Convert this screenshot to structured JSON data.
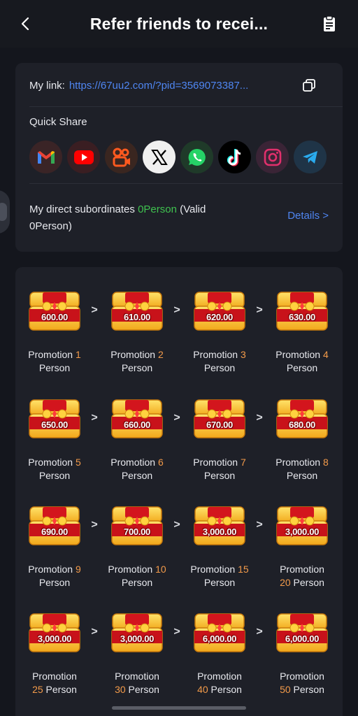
{
  "header": {
    "title": "Refer friends to recei...",
    "back_icon": "chevron-left-icon",
    "right_icon": "clipboard-icon"
  },
  "referral": {
    "link_label": "My link:",
    "link_url": "https://67uu2.com/?pid=3569073387...",
    "copy_icon": "copy-icon"
  },
  "quick_share": {
    "title": "Quick Share",
    "apps": [
      {
        "name": "gmail",
        "bg": "#3a2426"
      },
      {
        "name": "youtube",
        "bg": "#3a1e22"
      },
      {
        "name": "kuaishou",
        "bg": "#3a2620"
      },
      {
        "name": "x",
        "bg": "#f0f0f0"
      },
      {
        "name": "whatsapp",
        "bg": "#1f3a29"
      },
      {
        "name": "tiktok",
        "bg": "#000000"
      },
      {
        "name": "instagram",
        "bg": "#3a2436"
      },
      {
        "name": "telegram",
        "bg": "#1f3447"
      }
    ]
  },
  "subordinates": {
    "text_prefix": "My direct subordinates ",
    "count": "0Person",
    "valid_prefix": " (Valid",
    "valid_line2": "0Person)",
    "details_label": "Details >"
  },
  "rewards": [
    {
      "amount": "600.00",
      "label": "Promotion",
      "num": "1",
      "unit": "Person"
    },
    {
      "amount": "610.00",
      "label": "Promotion",
      "num": "2",
      "unit": "Person"
    },
    {
      "amount": "620.00",
      "label": "Promotion",
      "num": "3",
      "unit": "Person"
    },
    {
      "amount": "630.00",
      "label": "Promotion",
      "num": "4",
      "unit": "Person"
    },
    {
      "amount": "650.00",
      "label": "Promotion",
      "num": "5",
      "unit": "Person"
    },
    {
      "amount": "660.00",
      "label": "Promotion",
      "num": "6",
      "unit": "Person"
    },
    {
      "amount": "670.00",
      "label": "Promotion",
      "num": "7",
      "unit": "Person"
    },
    {
      "amount": "680.00",
      "label": "Promotion",
      "num": "8",
      "unit": "Person"
    },
    {
      "amount": "690.00",
      "label": "Promotion",
      "num": "9",
      "unit": "Person"
    },
    {
      "amount": "700.00",
      "label": "Promotion",
      "num": "10",
      "unit": "Person"
    },
    {
      "amount": "3,000.00",
      "label": "Promotion",
      "num": "15",
      "unit": "Person"
    },
    {
      "amount": "3,000.00",
      "label": "Promotion",
      "num": "20",
      "unit": "Person"
    },
    {
      "amount": "3,000.00",
      "label": "Promotion",
      "num": "25",
      "unit": "Person"
    },
    {
      "amount": "3,000.00",
      "label": "Promotion",
      "num": "30",
      "unit": "Person"
    },
    {
      "amount": "6,000.00",
      "label": "Promotion",
      "num": "40",
      "unit": "Person"
    },
    {
      "amount": "6,000.00",
      "label": "Promotion",
      "num": "50",
      "unit": "Person"
    }
  ],
  "arrow_glyph": ">",
  "colors": {
    "accent_blue": "#4f86f2",
    "accent_green": "#3fc24f",
    "accent_orange": "#f29a4a",
    "card_bg": "#1e2028",
    "page_bg": "#14161d"
  }
}
